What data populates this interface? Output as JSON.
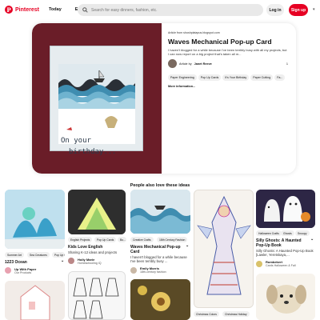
{
  "header": {
    "logo_text": "Pinterest",
    "nav": [
      "Today",
      "Explore"
    ],
    "search_placeholder": "Search for easy dinners, fashion, etc.",
    "login": "Log in",
    "signup": "Sign up"
  },
  "pin": {
    "source": "Article from shoshplatapus.blogspot.com",
    "title": "Waves Mechanical Pop-up Card",
    "description": "I haven't blogged for a while because I've been terribly busy with all my projects, but I can now report on a big project that's taken all m...",
    "author_label": "Article by",
    "author": "Janet Reeve",
    "count": "1",
    "tags": [
      "Paper Engineering",
      "Pop Up Cards",
      "It's Your Birthday",
      "Paper Cutting",
      "Fa..."
    ],
    "more": "More information...",
    "image_text_1": "On your",
    "image_text_2": "birthday..."
  },
  "also_like": "People also love these ideas",
  "pins": [
    {
      "tags": [
        "Summer Art",
        "Sea Creatures",
        "Pop Up Car..."
      ],
      "title": "1223 Ocean",
      "user": "Up With Paper",
      "sub": "Our Products"
    },
    {
      "tags": [
        "English Projects",
        "Pop Up Cards",
        "Bo..."
      ],
      "title": "Kids Love English",
      "desc": "Sharing K-12 ideas and projects",
      "user": "Holly Marie",
      "sub": "Homeschooling IQ"
    },
    {
      "tags": [
        "Creative Crafts",
        "18th Century Fashion"
      ],
      "title": "Waves Mechanical Pop-up Card",
      "desc": "I haven't blogged for a while because I've been terribly busy ...",
      "user": "Emily Morris",
      "sub": "18th-century fashion"
    },
    {
      "tags": [
        "Christmas Colors",
        "Christmas Holiday"
      ]
    },
    {
      "tags": [
        "Halloween Crafts",
        "Ghosts",
        "Snoopy",
        "..."
      ],
      "title": "Silly Ghosts: A Haunted Pop-Up Book",
      "desc": "Silly Ghosts: A Haunted Pop-Up Book [Lawler, Yeretskaya,...",
      "user": "Rumbekert",
      "sub": "Cards Halloween & Fall"
    }
  ],
  "colors": {
    "brand": "#e60023",
    "image_bg": "#6a1d28"
  }
}
